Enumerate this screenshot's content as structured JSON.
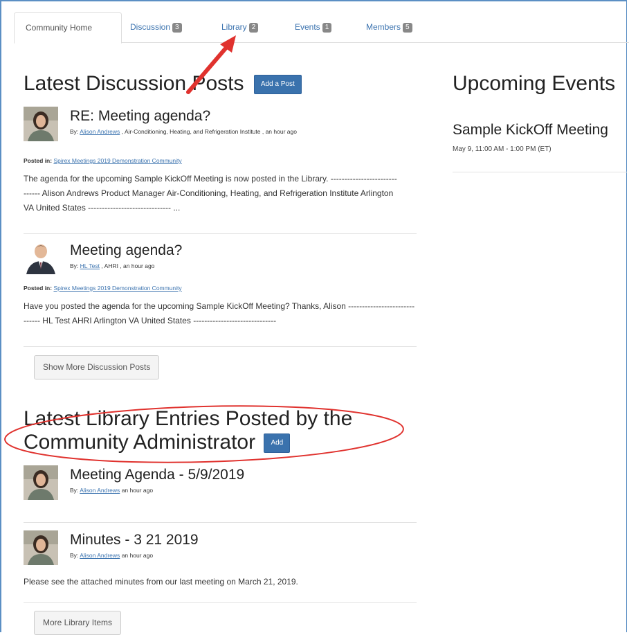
{
  "tabs": [
    {
      "label": "Community Home",
      "badge": ""
    },
    {
      "label": "Discussion",
      "badge": "3"
    },
    {
      "label": "Library",
      "badge": "2"
    },
    {
      "label": "Events",
      "badge": "1"
    },
    {
      "label": "Members",
      "badge": "5"
    }
  ],
  "discussion": {
    "heading": "Latest Discussion Posts",
    "add_button": "Add a Post",
    "posts": [
      {
        "title": "RE: Meeting agenda?",
        "by_label": "By:",
        "author": "Alison Andrews",
        "org_time": ", Air-Conditioning, Heating, and Refrigeration Institute , an hour ago",
        "posted_label": "Posted in:",
        "community": "Spirex Meetings 2019 Demonstration Community",
        "body": "The agenda for the upcoming Sample KickOff Meeting is now posted in the Library. ------------------------------ Alison Andrews Product Manager Air-Conditioning, Heating, and Refrigeration Institute Arlington VA United States ------------------------------ ..."
      },
      {
        "title": "Meeting agenda?",
        "by_label": "By:",
        "author": "HL Test",
        "org_time": ", AHRI , an hour ago",
        "posted_label": "Posted in:",
        "community": "Spirex Meetings 2019 Demonstration Community",
        "body": "Have you posted the agenda for the upcoming Sample KickOff Meeting? Thanks, Alison ------------------------------ HL Test AHRI Arlington VA United States ------------------------------"
      }
    ],
    "show_more": "Show More Discussion Posts"
  },
  "events": {
    "heading": "Upcoming Events",
    "items": [
      {
        "title": "Sample KickOff Meeting",
        "date": "May 9, 11:00 AM - 1:00 PM (ET)"
      }
    ]
  },
  "library": {
    "heading_line1": "Latest Library Entries Posted by the",
    "heading_line2": "Community Administrator",
    "add_button": "Add",
    "entries": [
      {
        "title": "Meeting Agenda - 5/9/2019",
        "by_label": "By:",
        "author": "Alison Andrews",
        "time": "an hour ago",
        "body": ""
      },
      {
        "title": "Minutes - 3 21 2019",
        "by_label": "By:",
        "author": "Alison Andrews",
        "time": "an hour ago",
        "body": "Please see the attached minutes from our last meeting on March 21, 2019."
      }
    ],
    "more": "More Library Items"
  },
  "colors": {
    "link": "#3b73af",
    "primary": "#3a72ad",
    "annotation": "#e0322e"
  }
}
